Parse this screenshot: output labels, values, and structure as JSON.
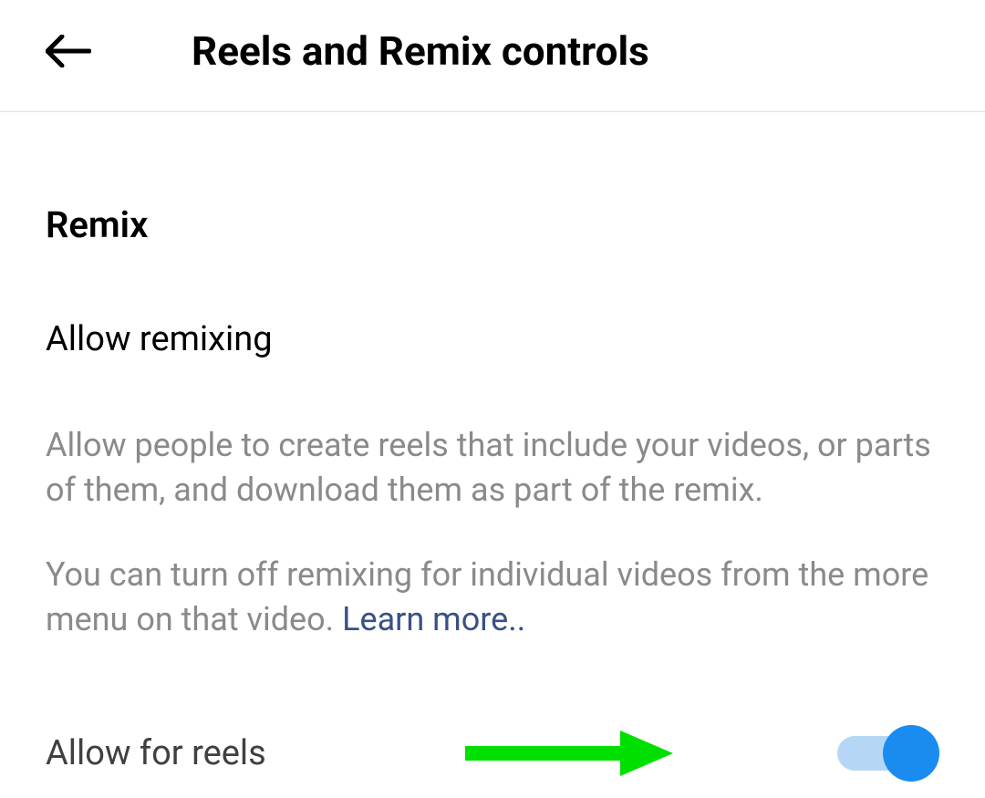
{
  "header": {
    "title": "Reels and Remix controls"
  },
  "section": {
    "title": "Remix",
    "setting_title": "Allow remixing",
    "description1": "Allow people to create reels that include your videos, or parts of them, and download them as part of the remix.",
    "description2_prefix": "You can turn off remixing for individual videos from the more menu on that video. ",
    "learn_more": "Learn more.."
  },
  "toggle": {
    "label": "Allow for reels",
    "state": "on"
  }
}
